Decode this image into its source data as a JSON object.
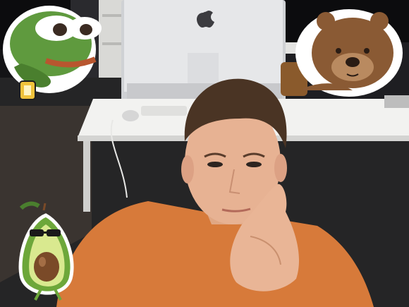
{
  "scene": {
    "kind": "webcam photo with decorative stickers",
    "stickers": [
      {
        "name": "frog-sticker",
        "icon": "frog-with-watch-icon"
      },
      {
        "name": "bear-sticker",
        "icon": "brown-bear-icon"
      },
      {
        "name": "avocado-sticker",
        "icon": "avocado-with-sunglasses-icon"
      }
    ],
    "subject_shirt_color": "#d77a3a",
    "desk_color": "#f2f2f0",
    "wall_color": "#101012"
  }
}
